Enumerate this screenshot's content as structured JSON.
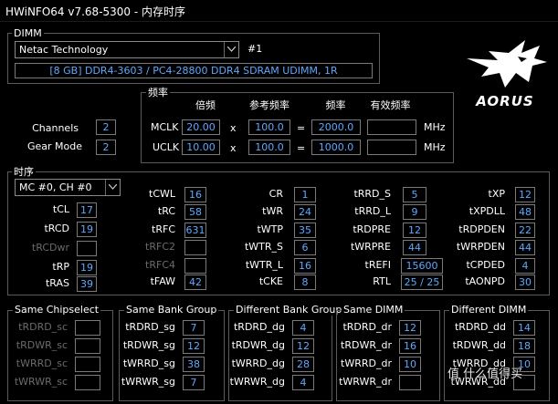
{
  "title": "HWiNFO64 v7.68-5300 - 内存时序",
  "dimm": {
    "group_label": "DIMM",
    "module": "Netac Technology",
    "slot": "#1",
    "info": "[8 GB] DDR4-3603 / PC4-28800 DDR4 SDRAM UDIMM, 1R"
  },
  "freq": {
    "group_label": "频率",
    "col_multiplier": "倍频",
    "col_ref": "参考频率",
    "col_freq": "频率",
    "col_eff": "有效频率",
    "mclk_label": "MCLK",
    "mclk_mult": "20.00",
    "mclk_ref": "100.0",
    "mclk_freq": "2000.0",
    "uclk_label": "UCLK",
    "uclk_mult": "10.00",
    "uclk_ref": "100.0",
    "uclk_freq": "1000.0",
    "times": "x",
    "equals": "=",
    "unit": "MHz"
  },
  "channels_label": "Channels",
  "channels": "2",
  "gearmode_label": "Gear Mode",
  "gearmode": "2",
  "brand": "AORUS",
  "timing": {
    "group_label": "时序",
    "selector": "MC #0, CH #0",
    "col1": [
      {
        "label": "tCL",
        "value": "17"
      },
      {
        "label": "tRCD",
        "value": "19"
      },
      {
        "label": "tRCDwr",
        "value": ""
      },
      {
        "label": "tRP",
        "value": "19"
      },
      {
        "label": "tRAS",
        "value": "39"
      }
    ],
    "col2": [
      {
        "label": "tCWL",
        "value": "16"
      },
      {
        "label": "tRC",
        "value": "58"
      },
      {
        "label": "tRFC",
        "value": "631"
      },
      {
        "label": "tRFC2",
        "value": ""
      },
      {
        "label": "tRFC4",
        "value": ""
      },
      {
        "label": "tFAW",
        "value": "42"
      }
    ],
    "col3": [
      {
        "label": "CR",
        "value": "1"
      },
      {
        "label": "tWR",
        "value": "24"
      },
      {
        "label": "tWTP",
        "value": "35"
      },
      {
        "label": "tWTR_S",
        "value": "6"
      },
      {
        "label": "tWTR_L",
        "value": "16"
      },
      {
        "label": "tCKE",
        "value": "8"
      }
    ],
    "col4": [
      {
        "label": "tRRD_S",
        "value": "5"
      },
      {
        "label": "tRRD_L",
        "value": "9"
      },
      {
        "label": "tRDPRE",
        "value": "12"
      },
      {
        "label": "tWRPRE",
        "value": "44"
      },
      {
        "label": "tREFI",
        "value": "15600"
      },
      {
        "label": "RTL",
        "value": "25 / 25"
      }
    ],
    "col5": [
      {
        "label": "tXP",
        "value": "12"
      },
      {
        "label": "tXPDLL",
        "value": "48"
      },
      {
        "label": "tRDPDEN",
        "value": "22"
      },
      {
        "label": "tWRPDEN",
        "value": "44"
      },
      {
        "label": "tCPDED",
        "value": "4"
      },
      {
        "label": "tAONPD",
        "value": "30"
      }
    ]
  },
  "bottom": {
    "same_chipselect": {
      "label": "Same Chipselect",
      "rows": [
        {
          "label": "tRDRD_sc",
          "value": ""
        },
        {
          "label": "tRDWR_sc",
          "value": ""
        },
        {
          "label": "tWRRD_sc",
          "value": ""
        },
        {
          "label": "tWRWR_sc",
          "value": ""
        }
      ]
    },
    "same_bank_group": {
      "label": "Same Bank Group",
      "rows": [
        {
          "label": "tRDRD_sg",
          "value": "7"
        },
        {
          "label": "tRDWR_sg",
          "value": "12"
        },
        {
          "label": "tWRRD_sg",
          "value": "38"
        },
        {
          "label": "tWRWR_sg",
          "value": "7"
        }
      ]
    },
    "diff_bank_group": {
      "label": "Different Bank Group",
      "rows": [
        {
          "label": "tRDRD_dg",
          "value": "4"
        },
        {
          "label": "tRDWR_dg",
          "value": "12"
        },
        {
          "label": "tWRRD_dg",
          "value": "28"
        },
        {
          "label": "tWRWR_dg",
          "value": "4"
        }
      ]
    },
    "same_dimm": {
      "label": "Same DIMM",
      "rows": [
        {
          "label": "tRDRD_dr",
          "value": "12"
        },
        {
          "label": "tRDWR_dr",
          "value": "16"
        },
        {
          "label": "tWRRD_dr",
          "value": "10"
        },
        {
          "label": "tWRWR_dr",
          "value": ""
        }
      ]
    },
    "diff_dimm": {
      "label": "Different DIMM",
      "rows": [
        {
          "label": "tRDRD_dd",
          "value": "14"
        },
        {
          "label": "tRDWR_dd",
          "value": "18"
        },
        {
          "label": "tWRRD_dd",
          "value": "10"
        },
        {
          "label": "tWRWR_dd",
          "value": ""
        }
      ]
    }
  },
  "watermark": "值 什么值得买",
  "colors": {
    "value_text": "#5ea8ff",
    "background": "#000000",
    "dim_label": "#6b6b6b"
  }
}
